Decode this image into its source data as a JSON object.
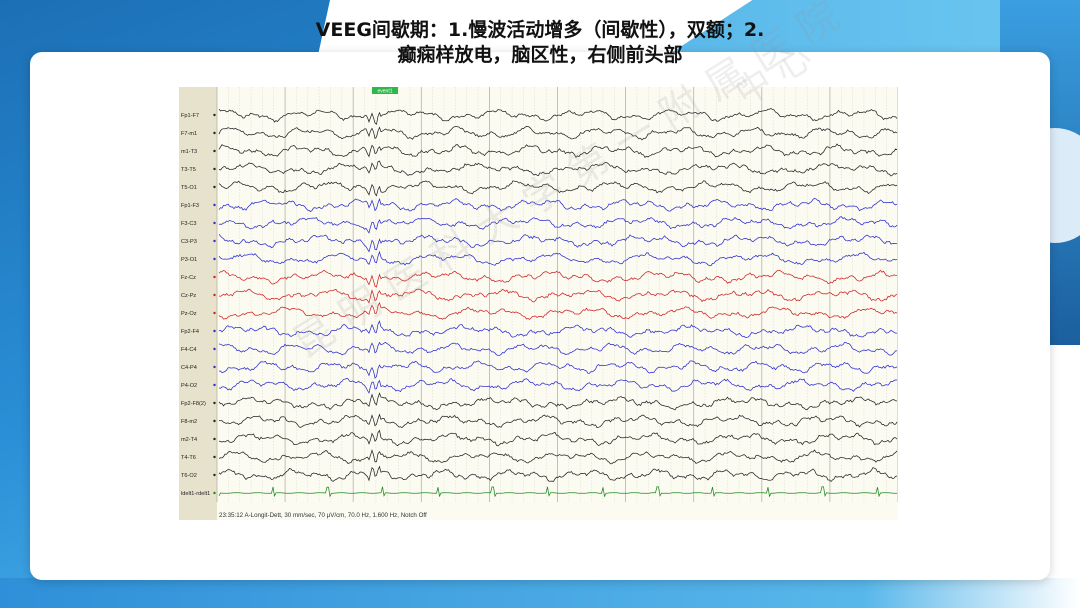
{
  "slide": {
    "title_line1": "VEEG间歇期：1.慢波活动增多（间歇性），双额；2.",
    "title_line2": "癫痫样放电，脑区性，右侧前头部",
    "watermark_top": "中心",
    "watermark": "昆明医科大学第一附属医院"
  },
  "eeg": {
    "marker_label": "event1",
    "footer": "23:35:12 A-Longit-Dett, 30 mm/sec, 70 µV/cm, 70.0 Hz, 1.600 Hz, Notch Off",
    "channels": [
      {
        "label": "Fp1-F7",
        "color": "#222222"
      },
      {
        "label": "F7-m1",
        "color": "#222222"
      },
      {
        "label": "m1-T3",
        "color": "#222222"
      },
      {
        "label": "T3-T5",
        "color": "#222222"
      },
      {
        "label": "T5-O1",
        "color": "#222222"
      },
      {
        "label": "Fp1-F3",
        "color": "#2b2bd0"
      },
      {
        "label": "F3-C3",
        "color": "#2b2bd0"
      },
      {
        "label": "C3-P3",
        "color": "#2b2bd0"
      },
      {
        "label": "P3-O1",
        "color": "#2b2bd0"
      },
      {
        "label": "Fz-Cz",
        "color": "#d02020"
      },
      {
        "label": "Cz-Pz",
        "color": "#d02020"
      },
      {
        "label": "Pz-Oz",
        "color": "#d02020"
      },
      {
        "label": "Fp2-F4",
        "color": "#2b2bd0"
      },
      {
        "label": "F4-C4",
        "color": "#2b2bd0"
      },
      {
        "label": "C4-P4",
        "color": "#2b2bd0"
      },
      {
        "label": "P4-O2",
        "color": "#2b2bd0"
      },
      {
        "label": "Fp2-F8(2)",
        "color": "#222222"
      },
      {
        "label": "F8-m2",
        "color": "#222222"
      },
      {
        "label": "m2-T4",
        "color": "#222222"
      },
      {
        "label": "T4-T6",
        "color": "#222222"
      },
      {
        "label": "T6-O2",
        "color": "#222222"
      },
      {
        "label": "ldelt1-rdelt1",
        "color": "#1a8a1a"
      }
    ],
    "colors": {
      "panel_bg": "#fbfbf2",
      "label_col_bg": "#e7e2cc",
      "grid_major": "#b8b3a0",
      "grid_minor": "#dcd8c8",
      "marker": "#2db84a"
    }
  }
}
